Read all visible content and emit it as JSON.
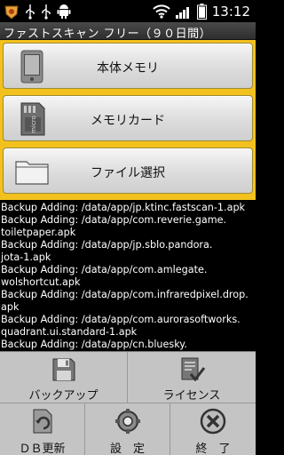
{
  "status_bar": {
    "time": "13:12",
    "icons": [
      "app-badge-icon",
      "usb-icon",
      "usb-icon",
      "android-icon",
      "wifi-icon",
      "signal-icon",
      "battery-icon"
    ]
  },
  "title": "ファストスキャン フリー（９０日間）",
  "buttons": [
    {
      "label": "本体メモリ",
      "icon": "phone-icon"
    },
    {
      "label": "メモリカード",
      "icon": "sd-card-icon"
    },
    {
      "label": "ファイル選択",
      "icon": "folder-icon"
    }
  ],
  "log_lines": [
    "Backup Adding: /data/app/jp.ktinc.fastscan-1.apk",
    "Backup Adding: /data/app/com.reverie.game.",
    "toiletpaper.apk",
    "Backup Adding: /data/app/jp.sblo.pandora.",
    "jota-1.apk",
    "Backup Adding: /data/app/com.amlegate.",
    "wolshortcut.apk",
    "Backup Adding: /data/app/com.infraredpixel.drop.",
    "apk",
    "Backup Adding: /data/app/com.aurorasoftworks.",
    "quadrant.ui.standard-1.apk",
    "Backup Adding: /data/app/cn.bluesky."
  ],
  "menu": {
    "backup": "バックアップ",
    "license": "ライセンス",
    "db_update": "ＤＢ更新",
    "settings": "設　定",
    "exit": "終　了"
  },
  "colors": {
    "panel": "#f3c11d",
    "background": "#000000"
  }
}
